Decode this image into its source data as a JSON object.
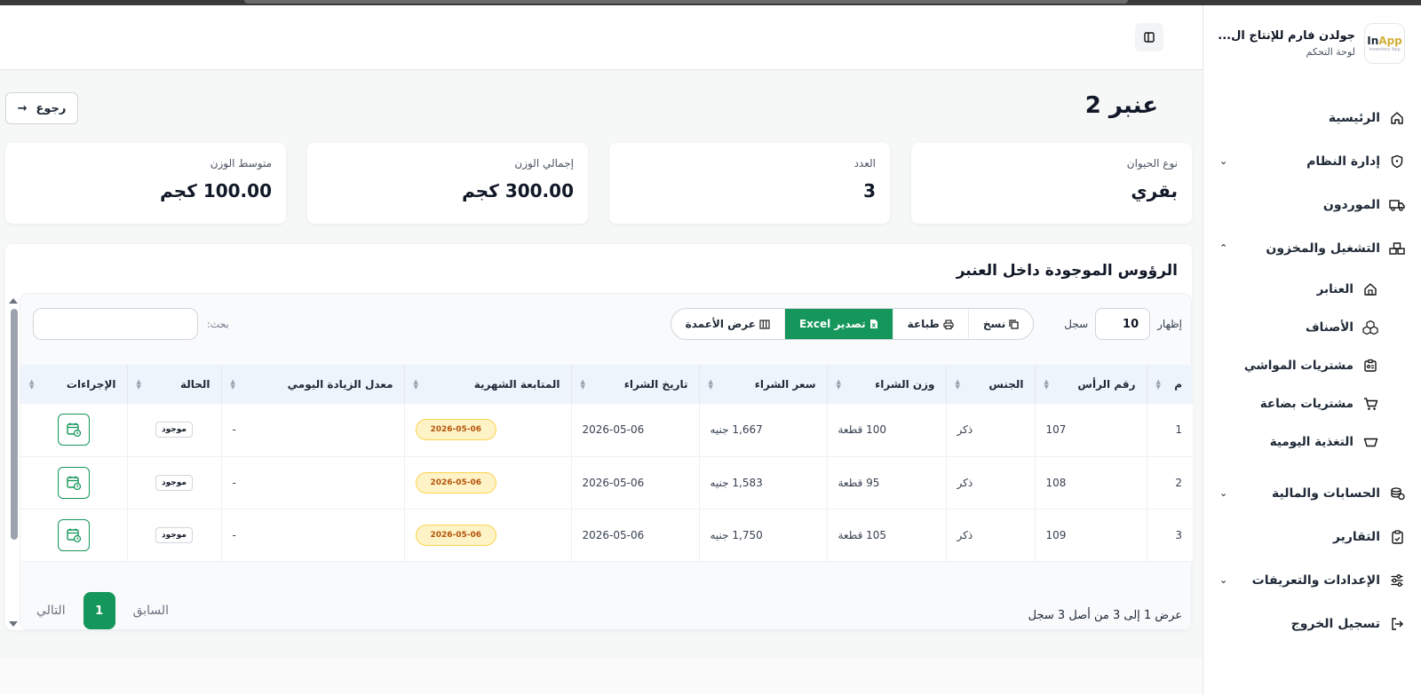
{
  "sidebar": {
    "logo": {
      "brand_main": "In",
      "brand_accent": "App",
      "brand_sub": "Inventory App"
    },
    "company_name": "جولدن فارم للإنتاج ال...",
    "subtitle": "لوحة التحكم",
    "items": [
      {
        "label": "الرئيسية",
        "icon": "home-icon"
      },
      {
        "label": "إدارة النظام",
        "icon": "shield-icon",
        "chevron": "⌄"
      },
      {
        "label": "الموردون",
        "icon": "truck-icon"
      },
      {
        "label": "التشغيل والمخزون",
        "icon": "boxes-icon",
        "chevron": "⌃"
      }
    ],
    "sub_items": [
      {
        "label": "العنابر",
        "icon": "barn-icon"
      },
      {
        "label": "الأصناف",
        "icon": "cubes-icon"
      },
      {
        "label": "مشتريات المواشي",
        "icon": "id-card-icon"
      },
      {
        "label": "مشتريات بضاعة",
        "icon": "cart-icon"
      },
      {
        "label": "التغذية اليومية",
        "icon": "bowl-icon"
      }
    ],
    "items_bottom": [
      {
        "label": "الحسابات والمالية",
        "icon": "coins-icon",
        "chevron": "⌄"
      },
      {
        "label": "التقارير",
        "icon": "clipboard-icon"
      },
      {
        "label": "الإعدادات والتعريفات",
        "icon": "sliders-icon",
        "chevron": "⌄"
      },
      {
        "label": "تسجيل الخروج",
        "icon": "logout-icon"
      }
    ]
  },
  "page": {
    "title": "عنبر 2",
    "back_label": "رجوع",
    "back_arrow": "→"
  },
  "stats": [
    {
      "label": "نوع الحيوان",
      "value": "بقري"
    },
    {
      "label": "العدد",
      "value": "3"
    },
    {
      "label": "إجمالي الوزن",
      "value": "300.00 كجم"
    },
    {
      "label": "متوسط الوزن",
      "value": "100.00 كجم"
    }
  ],
  "table_panel": {
    "title": "الرؤوس الموجودة داخل العنبر",
    "show_label": "إظهار",
    "length_value": "10",
    "records_label": "سجل",
    "buttons": {
      "copy": "نسخ",
      "print": "طباعة",
      "excel": "تصدير Excel",
      "columns": "عرض الأعمدة"
    },
    "search_label": "بحث:",
    "columns": [
      "م",
      "رقم الرأس",
      "الجنس",
      "وزن الشراء",
      "سعر الشراء",
      "تاريخ الشراء",
      "المتابعة الشهرية",
      "معدل الزيادة اليومي",
      "الحالة",
      "الإجراءات"
    ],
    "rows": [
      {
        "idx": "1",
        "tag": "107",
        "gender": "ذكر",
        "weight": "100 قطعة",
        "price": "1,667 جنيه",
        "date": "2026-05-06",
        "monthly": "2026-05-06",
        "daily_gain": "-",
        "status": "موجود"
      },
      {
        "idx": "2",
        "tag": "108",
        "gender": "ذكر",
        "weight": "95 قطعة",
        "price": "1,583 جنيه",
        "date": "2026-05-06",
        "monthly": "2026-05-06",
        "daily_gain": "-",
        "status": "موجود"
      },
      {
        "idx": "3",
        "tag": "109",
        "gender": "ذكر",
        "weight": "105 قطعة",
        "price": "1,750 جنيه",
        "date": "2026-05-06",
        "monthly": "2026-05-06",
        "daily_gain": "-",
        "status": "موجود"
      }
    ],
    "info": "عرض 1 إلى 3 من أصل 3 سجل",
    "pager": {
      "prev": "السابق",
      "current": "1",
      "next": "التالي"
    }
  },
  "colors": {
    "accent": "#15965a",
    "badge_bg": "#fef3c7",
    "badge_text": "#b45309"
  }
}
